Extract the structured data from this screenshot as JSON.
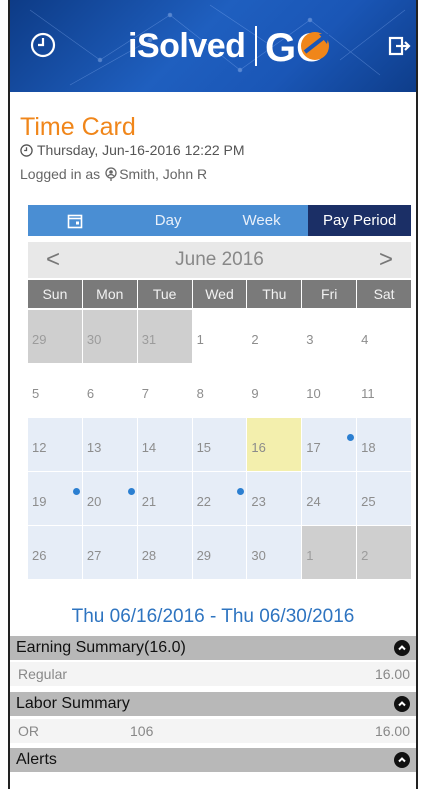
{
  "header": {
    "logo_text": "iSolved",
    "logo_badge": "GO",
    "icons": {
      "left": "clock-icon",
      "right": "logout-icon"
    },
    "colors": {
      "primary": "#1f5fbf",
      "accent": "#f0861a"
    }
  },
  "page": {
    "title": "Time Card",
    "datetime": "Thursday, Jun-16-2016 12:22 PM",
    "logged_in_prefix": "Logged in as",
    "user": "Smith, John R"
  },
  "tabs": [
    {
      "label": "",
      "icon": "calendar-icon",
      "active": false
    },
    {
      "label": "Day",
      "active": false
    },
    {
      "label": "Week",
      "active": false
    },
    {
      "label": "Pay Period",
      "active": true
    }
  ],
  "calendar": {
    "month": "June 2016",
    "prev": "<",
    "next": ">",
    "weekdays": [
      "Sun",
      "Mon",
      "Tue",
      "Wed",
      "Thu",
      "Fri",
      "Sat"
    ],
    "days": [
      {
        "n": "29",
        "state": "grey"
      },
      {
        "n": "30",
        "state": "grey"
      },
      {
        "n": "31",
        "state": "grey"
      },
      {
        "n": "1",
        "state": "normal"
      },
      {
        "n": "2",
        "state": "normal"
      },
      {
        "n": "3",
        "state": "normal"
      },
      {
        "n": "4",
        "state": "normal"
      },
      {
        "n": "5",
        "state": "normal"
      },
      {
        "n": "6",
        "state": "normal"
      },
      {
        "n": "7",
        "state": "normal"
      },
      {
        "n": "8",
        "state": "normal"
      },
      {
        "n": "9",
        "state": "normal"
      },
      {
        "n": "10",
        "state": "normal"
      },
      {
        "n": "11",
        "state": "normal"
      },
      {
        "n": "12",
        "state": "range"
      },
      {
        "n": "13",
        "state": "range"
      },
      {
        "n": "14",
        "state": "range"
      },
      {
        "n": "15",
        "state": "range"
      },
      {
        "n": "16",
        "state": "today"
      },
      {
        "n": "17",
        "state": "range",
        "dot": true
      },
      {
        "n": "18",
        "state": "range"
      },
      {
        "n": "19",
        "state": "range",
        "dot": true
      },
      {
        "n": "20",
        "state": "range",
        "dot": true
      },
      {
        "n": "21",
        "state": "range"
      },
      {
        "n": "22",
        "state": "range",
        "dot": true
      },
      {
        "n": "23",
        "state": "range"
      },
      {
        "n": "24",
        "state": "range"
      },
      {
        "n": "25",
        "state": "range"
      },
      {
        "n": "26",
        "state": "range"
      },
      {
        "n": "27",
        "state": "range"
      },
      {
        "n": "28",
        "state": "range"
      },
      {
        "n": "29",
        "state": "range"
      },
      {
        "n": "30",
        "state": "range"
      },
      {
        "n": "1",
        "state": "grey"
      },
      {
        "n": "2",
        "state": "grey"
      }
    ]
  },
  "range_label": "Thu 06/16/2016 - Thu 06/30/2016",
  "sections": {
    "earning": {
      "title": "Earning Summary(16.0)",
      "rows": [
        {
          "label": "Regular",
          "code": "",
          "value": "16.00"
        }
      ]
    },
    "labor": {
      "title": "Labor Summary",
      "rows": [
        {
          "label": "OR",
          "code": "106",
          "value": "16.00"
        }
      ]
    },
    "alerts": {
      "title": "Alerts"
    }
  }
}
